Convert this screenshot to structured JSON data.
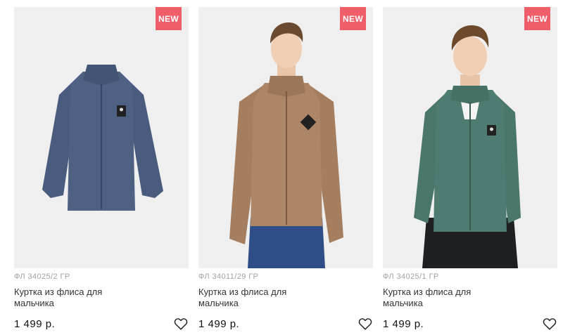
{
  "colors": {
    "badge": "#f05e6a",
    "photo_bg": "#efefef",
    "navy_jacket": "#4e6183",
    "beige_jacket": "#ad8567",
    "green_jacket": "#4e7c72"
  },
  "products": [
    {
      "badge": "NEW",
      "sku": "ФЛ 34025/2 ГР",
      "title": "Куртка из флиса для мальчика",
      "price": "1 499 р.",
      "image": "navy-fleece-jacket-photo",
      "favorite_icon": "heart-icon"
    },
    {
      "badge": "NEW",
      "sku": "ФЛ 34011/29 ГР",
      "title": "Куртка из флиса для мальчика",
      "price": "1 499 р.",
      "image": "beige-fleece-jacket-model-photo",
      "favorite_icon": "heart-icon"
    },
    {
      "badge": "NEW",
      "sku": "ФЛ 34025/1 ГР",
      "title": "Куртка из флиса для мальчика",
      "price": "1 499 р.",
      "image": "green-fleece-jacket-model-photo",
      "favorite_icon": "heart-icon"
    }
  ]
}
